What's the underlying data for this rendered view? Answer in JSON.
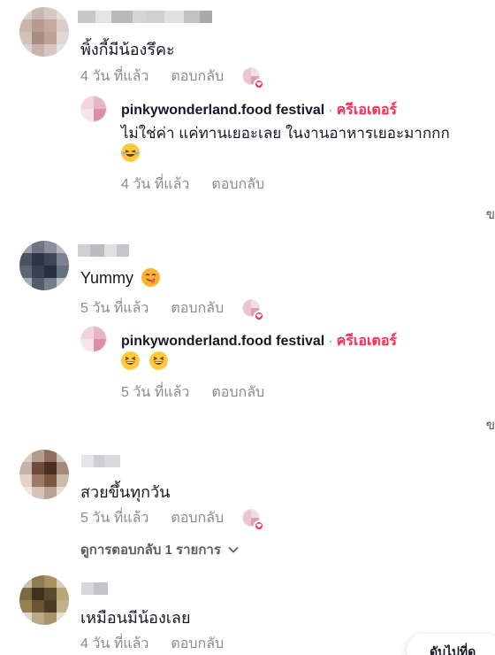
{
  "comments": [
    {
      "text": "พิ้งกี้มีน้องรึคะ",
      "time": "4 วัน ที่แล้ว",
      "reply_label": "ตอบกลับ",
      "reply": {
        "author": "pinkywonderland.food festival",
        "separator": "·",
        "badge": "ครีเอเตอร์",
        "line1": "ไม่ใช่ค่า แค่ทานเยอะเลย ในงานอาหารเยอะมากกก",
        "time": "4 วัน ที่แล้ว",
        "reply_label": "ตอบกลับ"
      }
    },
    {
      "text": "Yummy",
      "time": "5 วัน ที่แล้ว",
      "reply_label": "ตอบกลับ",
      "reply": {
        "author": "pinkywonderland.food festival",
        "separator": "·",
        "badge": "ครีเอเตอร์",
        "time": "5 วัน ที่แล้ว",
        "reply_label": "ตอบกลับ"
      }
    },
    {
      "text": "สวยขึ้นทุกวัน",
      "time": "5 วัน ที่แล้ว",
      "reply_label": "ตอบกลับ",
      "view_replies": "ดูการตอบกลับ 1 รายการ"
    },
    {
      "text": "เหมือนมีน้องเลย",
      "time": "4 วัน ที่แล้ว",
      "reply_label": "ตอบกลับ"
    }
  ],
  "edge_char": "ข",
  "floating_button": "ดับไปที่ด",
  "icons": {
    "liked_by_creator": "creator-liked-heart-icon",
    "chevron": "chevron-down-icon",
    "emoji_laugh": "laughing-tears-emoji-icon",
    "emoji_yum": "yum-face-emoji-icon",
    "emoji_grin": "squinting-grin-emoji-icon"
  },
  "colors": {
    "creator_badge": "#fe2c55",
    "secondary_text": "#8a8b91",
    "primary_text": "#161823"
  }
}
